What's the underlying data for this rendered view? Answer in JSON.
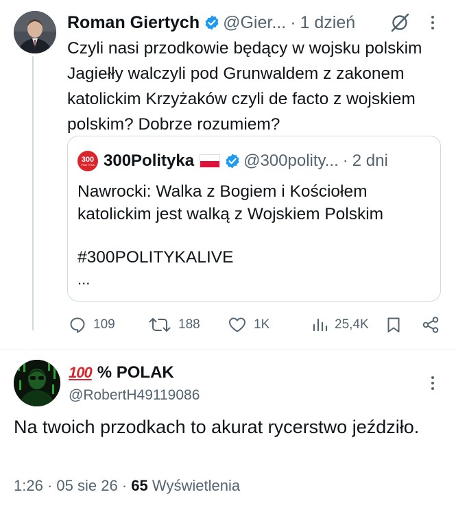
{
  "tweet1": {
    "author_name": "Roman Giertych",
    "handle": "@Gier...",
    "time": "1 dzień",
    "text": "Czyli nasi przodkowie będący w wojsku polskim Jagiełły walczyli pod Grunwaldem z zakonem katolickim Krzyżaków czyli de facto z wojskiem polskim? Dobrze rozumiem?",
    "quote": {
      "logo_text": "300",
      "logo_subtext": "POLITYKA",
      "author_name": "300Polityka",
      "flag": "poland-flag",
      "handle": "@300polity...",
      "time": "2 dni",
      "text": "Nawrocki: Walka z Bogiem i Kościołem katolickim jest walką z Wojskiem Polskim",
      "hashtag": "#300POLITYKALIVE",
      "ellipsis": "..."
    },
    "actions": {
      "replies": "109",
      "retweets": "188",
      "likes": "1K",
      "views": "25,4K"
    }
  },
  "tweet2": {
    "badge": "💯",
    "badge_text": "100",
    "author_name": "% POLAK",
    "handle": "@RobertH49119086",
    "text": "Na twoich przodkach to akurat rycerstwo jeździło.",
    "time": "1:26",
    "date": "05 sie 26",
    "views_count": "65",
    "views_label": "Wyświetlenia"
  },
  "colors": {
    "text": "#0f1419",
    "muted": "#536471",
    "verified": "#1d9bf0",
    "border": "#cfd9de",
    "brand_red": "#d8262c"
  }
}
